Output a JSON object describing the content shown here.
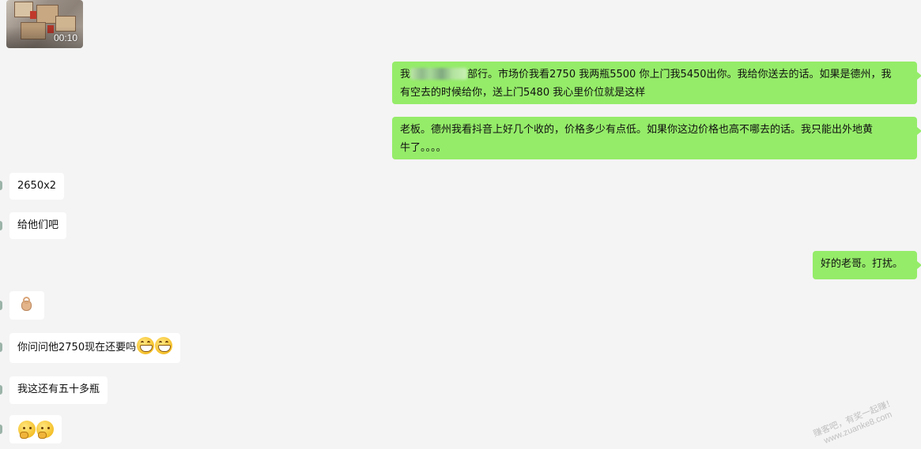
{
  "video": {
    "duration": "00:10"
  },
  "messages": [
    {
      "dir": "out",
      "parts": {
        "prefix": "我",
        "suffix": "部行。市场价我看2750  我两瓶5500  你上门我5450出你。我给你送去的话。如果是德州，我",
        "line2": "有空去的时候给你，送上门5480   我心里价位就是这样"
      }
    },
    {
      "dir": "out",
      "line1": "老板。德州我看抖音上好几个收的，价格多少有点低。如果你这边价格也高不哪去的话。我只能出外地黄",
      "line2": "牛了。。。。"
    },
    {
      "dir": "in",
      "text": "2650x2"
    },
    {
      "dir": "in",
      "text": "给他们吧"
    },
    {
      "dir": "out",
      "text": "好的老哥。打扰。"
    },
    {
      "dir": "in",
      "icon": "ok-hand-icon"
    },
    {
      "dir": "in",
      "text": "你问问他2750现在还要吗",
      "icons": [
        "grinning-face-icon",
        "grinning-face-icon"
      ]
    },
    {
      "dir": "in",
      "text": "我这还有五十多瓶"
    },
    {
      "dir": "in",
      "icons": [
        "thinking-face-icon",
        "thinking-face-icon"
      ]
    }
  ],
  "watermark": {
    "line1": "赚客吧，有奖一起赚！",
    "line2": "www.zuanke8.com"
  },
  "colors": {
    "background": "#f4f4f4",
    "outgoing_bubble": "#95ec69",
    "incoming_bubble": "#ffffff"
  }
}
